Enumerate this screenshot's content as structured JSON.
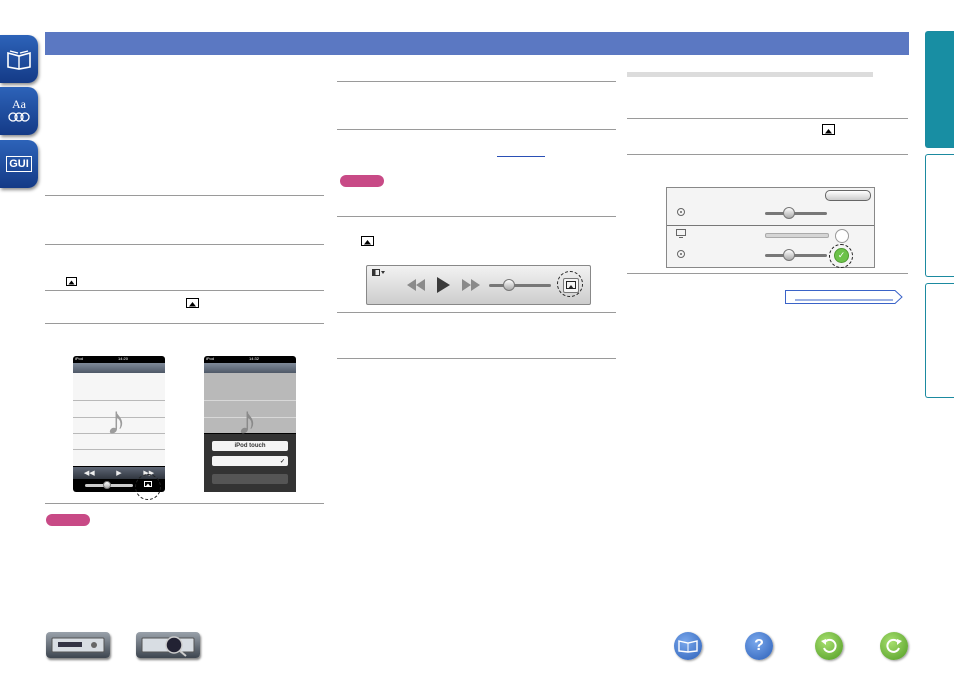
{
  "left_tabs": [
    {
      "icon": "book-icon",
      "label": ""
    },
    {
      "icon": "glossary-icon",
      "label": "Aa"
    },
    {
      "icon": "gui-icon",
      "label": "GUI"
    }
  ],
  "phone1": {
    "status_left": "iPod",
    "status_time": "14:20"
  },
  "phone2": {
    "status_left": "iPod",
    "status_time": "14:32",
    "item1": "iPod touch"
  },
  "colors": {
    "banner": "#5b78c2",
    "note_badge": "#c84a86",
    "right_tab_active": "#188ea3"
  },
  "bottom_icons": [
    "receiver-icon",
    "receiver-magnify-icon",
    "manual-book-icon",
    "help-icon",
    "back-icon",
    "forward-icon"
  ]
}
